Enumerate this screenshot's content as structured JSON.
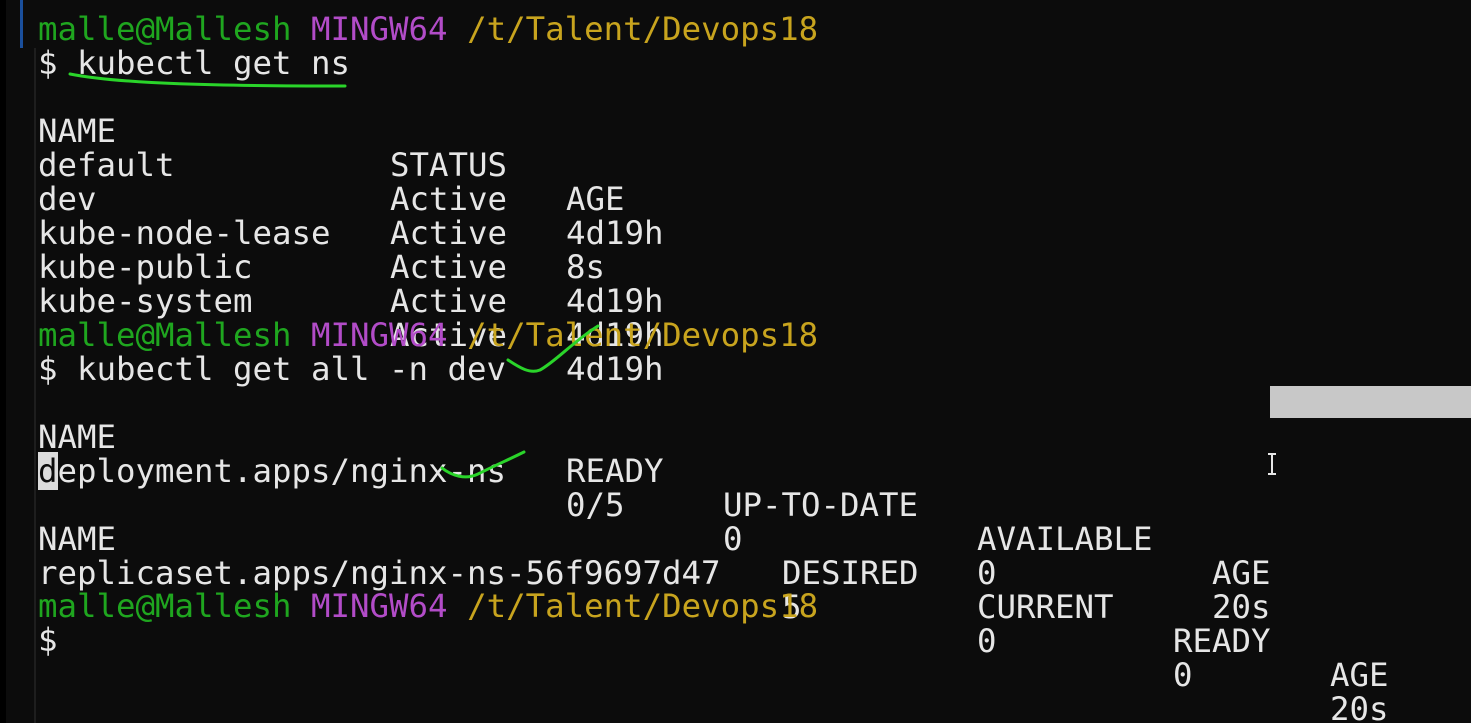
{
  "prompt": {
    "user": "malle@Mallesh",
    "host": "MINGW64",
    "path": "/t/Talent/Devops18",
    "symbol": "$"
  },
  "commands": {
    "cmd1": "kubectl get ns",
    "cmd2": "kubectl get all -n dev"
  },
  "ns_table": {
    "headers": [
      "NAME",
      "STATUS",
      "AGE"
    ],
    "rows": [
      [
        "default",
        "Active",
        "4d19h"
      ],
      [
        "dev",
        "Active",
        "8s"
      ],
      [
        "kube-node-lease",
        "Active",
        "4d19h"
      ],
      [
        "kube-public",
        "Active",
        "4d19h"
      ],
      [
        "kube-system",
        "Active",
        "4d19h"
      ]
    ]
  },
  "deploy_table": {
    "headers": [
      "NAME",
      "READY",
      "UP-TO-DATE",
      "AVAILABLE",
      "AGE"
    ],
    "row_first_char": "d",
    "row_name_rest": "eployment.apps/nginx-ns",
    "row": [
      "deployment.apps/nginx-ns",
      "0/5",
      "0",
      "0",
      "20s"
    ]
  },
  "rs_table": {
    "headers": [
      "NAME",
      "DESIRED",
      "CURRENT",
      "READY",
      "AGE"
    ],
    "row": [
      "replicaset.apps/nginx-ns-56f9697d47",
      "5",
      "0",
      "0",
      "20s"
    ]
  },
  "colors": {
    "user": "#1fa61f",
    "host": "#b24cc8",
    "path": "#c8a41e",
    "annotation": "#2ad42a",
    "text": "#e6e6e6",
    "background": "#0c0c0c"
  }
}
